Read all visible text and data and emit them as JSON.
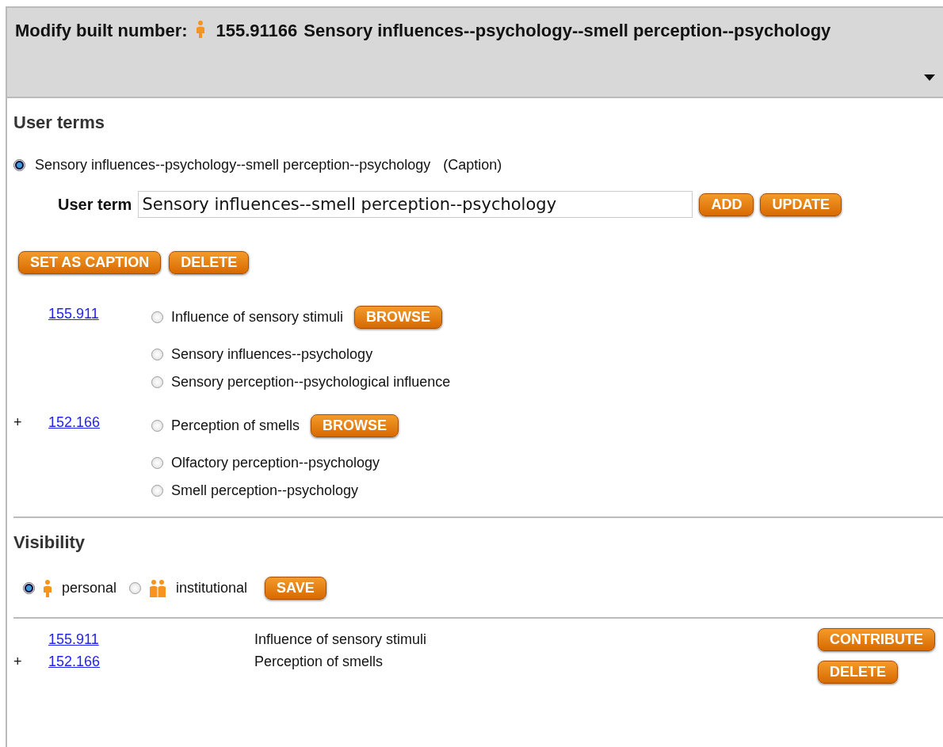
{
  "header": {
    "label": "Modify built number:",
    "number": "155.91166",
    "title": "Sensory influences--psychology--smell perception--psychology"
  },
  "user_terms": {
    "heading": "User terms",
    "caption_option": {
      "text": "Sensory influences--psychology--smell perception--psychology",
      "note": "(Caption)",
      "selected": true
    },
    "field_label": "User term",
    "field_value": "Sensory influences--smell perception--psychology",
    "field_buttons": [
      "ADD",
      "UPDATE"
    ],
    "action_buttons": [
      "SET AS CAPTION",
      "DELETE"
    ],
    "components": [
      {
        "number": "155.911",
        "terms": [
          {
            "text": "Influence of sensory stimuli",
            "selected": false,
            "button": "BROWSE"
          },
          {
            "text": "Sensory influences--psychology",
            "selected": false
          },
          {
            "text": "Sensory perception--psychological influence",
            "selected": false
          }
        ]
      },
      {
        "prefix": "+",
        "number": "152.166",
        "terms": [
          {
            "text": "Perception of smells",
            "selected": false,
            "button": "BROWSE"
          },
          {
            "text": "Olfactory perception--psychology",
            "selected": false
          },
          {
            "text": "Smell perception--psychology",
            "selected": false
          }
        ]
      }
    ]
  },
  "visibility": {
    "heading": "Visibility",
    "options": [
      {
        "kind": "personal",
        "label": "personal",
        "selected": true
      },
      {
        "kind": "institutional",
        "label": "institutional",
        "selected": false
      }
    ],
    "button": "SAVE"
  },
  "summary": {
    "rows": [
      {
        "number": "155.911",
        "text": "Influence of sensory stimuli"
      },
      {
        "prefix": "+",
        "number": "152.166",
        "text": "Perception of smells"
      }
    ],
    "buttons": [
      "CONTRIBUTE",
      "DELETE"
    ]
  }
}
